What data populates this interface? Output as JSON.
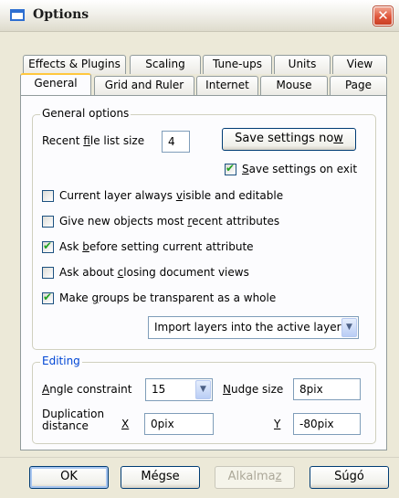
{
  "window": {
    "title": "Options",
    "close_glyph": "✕"
  },
  "tabs": {
    "back_row": [
      "Effects & Plugins",
      "Scaling",
      "Tune-ups",
      "Units",
      "View"
    ],
    "front_row": [
      "General",
      "Grid and Ruler",
      "Internet",
      "Mouse",
      "Page"
    ],
    "active": "General"
  },
  "general_options": {
    "group_title": "General options",
    "recent_files": {
      "label_pre": "Recent ",
      "label_key": "f",
      "label_post": "ile list size",
      "value": "4"
    },
    "save_now": {
      "pre": "Save settings no",
      "key": "w",
      "post": ""
    },
    "save_on_exit": {
      "pre": "",
      "key": "S",
      "post": "ave settings on exit",
      "checked": true
    },
    "checkboxes": [
      {
        "pre": "Current layer always ",
        "key": "v",
        "post": "isible and editable",
        "checked": false
      },
      {
        "pre": "Give new objects most ",
        "key": "r",
        "post": "ecent attributes",
        "checked": false
      },
      {
        "pre": "Ask ",
        "key": "b",
        "post": "efore setting current attribute",
        "checked": true
      },
      {
        "pre": "Ask about ",
        "key": "c",
        "post": "losing document views",
        "checked": false
      },
      {
        "pre": "Make ",
        "key": "g",
        "post": "roups be transparent as a whole",
        "checked": true
      }
    ],
    "import_select": {
      "selected": "Import layers into the active layer"
    }
  },
  "editing": {
    "group_title": "Editing",
    "angle": {
      "key": "A",
      "post": "ngle constraint",
      "value": "15"
    },
    "nudge": {
      "key": "N",
      "post": "udge size",
      "value": "8pix"
    },
    "duplication": {
      "label_line1": "Duplication",
      "label_line2": "distance",
      "x_label": "X",
      "x_value": "0pix",
      "y_label": "Y",
      "y_value": "-80pix"
    }
  },
  "buttons": {
    "ok": "OK",
    "cancel": "Mégse",
    "apply_pre": "Alkalma",
    "apply_key": "z",
    "apply_post": "",
    "help": "Súgó"
  },
  "colors": {
    "accent": "#0046d5",
    "tab_highlight": "#ffc73d",
    "check": "#21a121",
    "close": "#e0563b"
  }
}
